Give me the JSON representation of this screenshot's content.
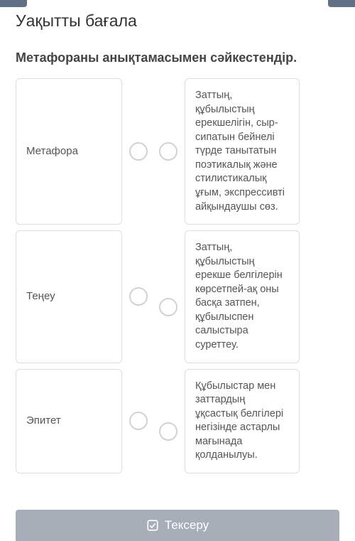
{
  "title": "Уақытты бағала",
  "question": "Метафораны анықтамасымен сәйкестендір.",
  "pairs": [
    {
      "term": "Метафора",
      "definition": "Заттың, құбылыстың ерекшелігін, сыр-сипатын бейнелі түрде танытатын поэтикалық және стилистикалық ұғым, экспрессивті айқындаушы сөз."
    },
    {
      "term": "Теңеу",
      "definition": "Заттың, құбылыстың ерекше белгілерін көрсетпей-ақ оны басқа затпен, құбылыспен салыстыра суреттеу."
    },
    {
      "term": "Эпитет",
      "definition": "Құбылыстар мен заттардың ұқсастық белгілері негізінде астарлы мағынада қолданылуы."
    }
  ],
  "checkLabel": "Тексеру"
}
